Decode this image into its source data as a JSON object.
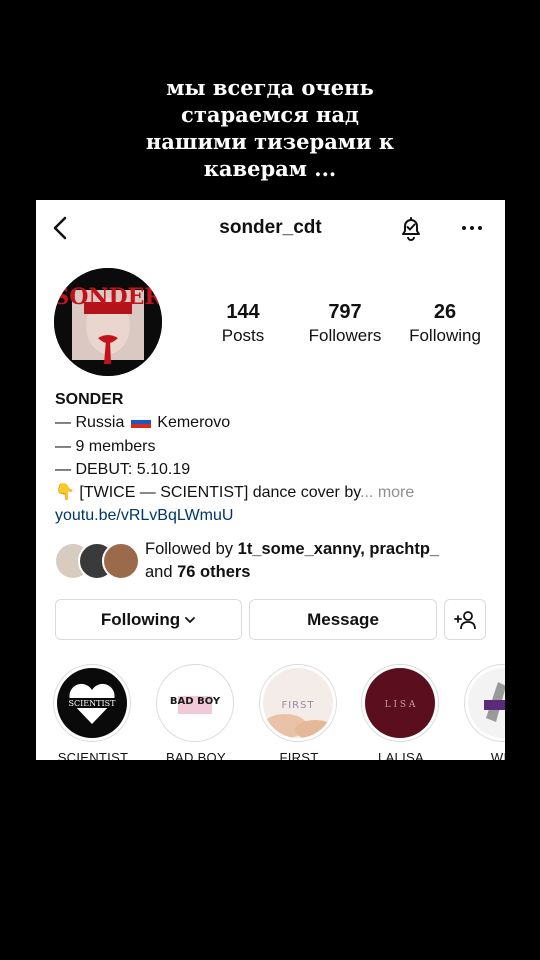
{
  "caption": {
    "lines": [
      "мы всегда очень",
      "стараемся над",
      "нашими тизерами к",
      "каверам ..."
    ]
  },
  "header": {
    "username": "sonder_cdt",
    "icons": {
      "back": "chevron-left-icon",
      "bell": "bell-check-icon",
      "more": "ellipsis-icon"
    }
  },
  "profile": {
    "avatar_text": "SONDER",
    "stats": [
      {
        "value": "144",
        "label": "Posts"
      },
      {
        "value": "797",
        "label": "Followers"
      },
      {
        "value": "26",
        "label": "Following"
      }
    ],
    "bio": {
      "name": "SONDER",
      "line1_prefix": "— Russia",
      "line1_suffix": "Kemerovo",
      "line2": "— 9 members",
      "line3": "— DEBUT: 5.10.19",
      "line4": "👇 [TWICE — SCIENTIST] dance cover by",
      "more_label": "... more",
      "link": "youtu.be/vRLvBqLWmuU"
    },
    "followed_by": {
      "prefix": "Followed by",
      "users": "1t_some_xanny, prachtp_",
      "and": "and",
      "others": "76 others"
    }
  },
  "actions": {
    "following_label": "Following",
    "message_label": "Message"
  },
  "highlights": [
    {
      "label": "SCIENTIST",
      "inner_text": "SCIENTIST"
    },
    {
      "label": "BAD BOY",
      "inner_text": "BAD BOY"
    },
    {
      "label": "FIRST",
      "inner_text": "FIRST"
    },
    {
      "label": "LALISA",
      "inner_text": "L I S A"
    },
    {
      "label": "WIN",
      "inner_text": ""
    }
  ],
  "colors": {
    "link": "#00376b",
    "muted": "#8e8e8e",
    "border": "#dbdbdb"
  }
}
